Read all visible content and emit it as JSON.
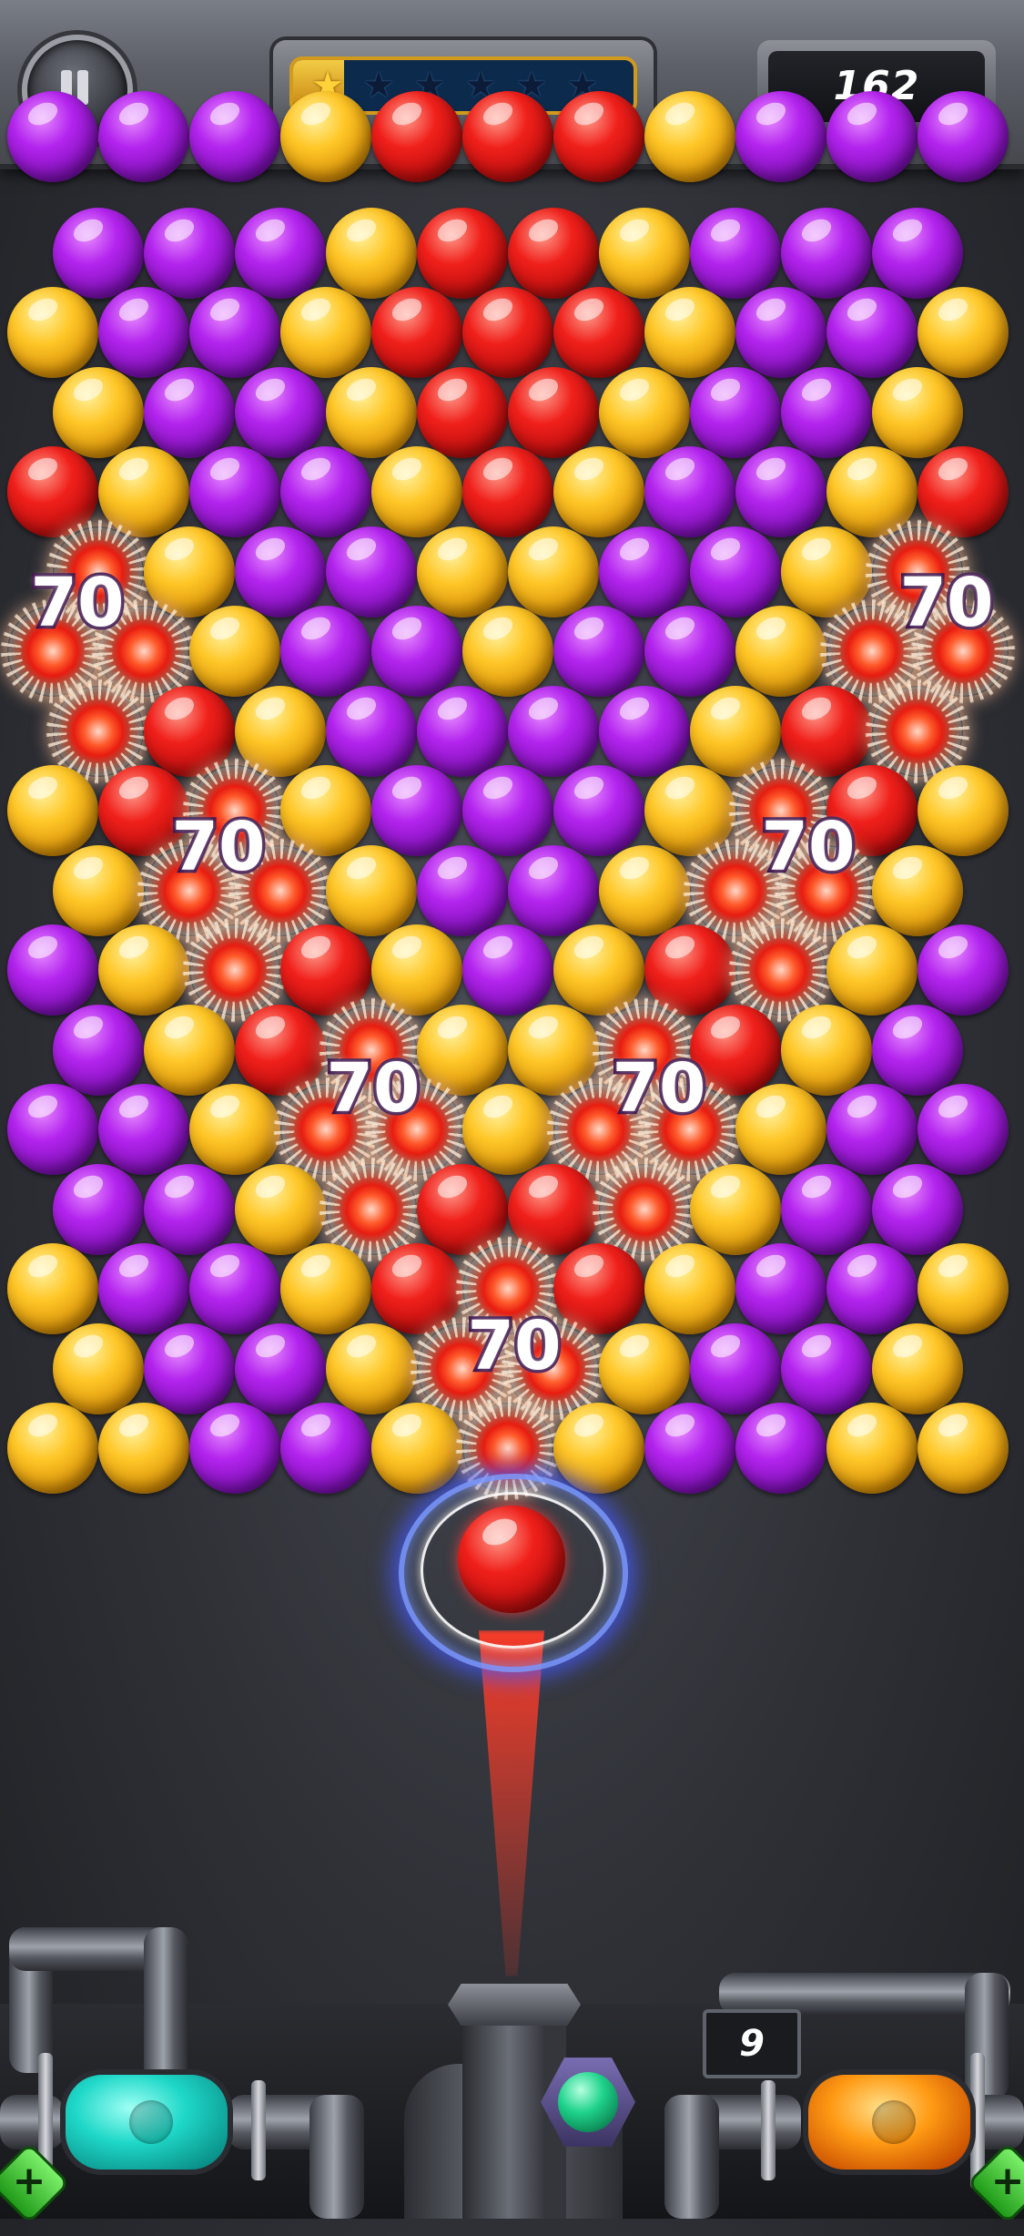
{
  "hud": {
    "pause_icon": "pause-icon",
    "star_progress": {
      "stars_total": 6,
      "stars_earned": 1,
      "fill_fraction": 0.15,
      "star_icon": "star-icon"
    },
    "score": "162"
  },
  "colors": {
    "purple": "#b324ee",
    "yellow": "#ffc728",
    "red": "#f0201b",
    "teal_booster": "#1fd8c8",
    "amber_booster": "#ff9a14",
    "next_bubble": "#1fd38b"
  },
  "board": {
    "rows": [
      "PPPYRRRYPPP",
      "PPPYRRYPPP",
      "YPPYRRRYPPY",
      "YPPYRRYPPY",
      "RYPPYRYPPYR",
      "XYPPYYPPYX",
      "XXYPPYPPYXX",
      "XRYPPPPYRX",
      "YRXYPPPYXRY",
      "YXXYPPYXXY",
      "PYXRYPYRXYP",
      "PYRXYYXRYP",
      "PPYXXYXXYPP",
      "PPYXRRXYPP",
      "YPPYRXRYPPY",
      "YPPYXXYPPY",
      "YYPPYXYPPYY"
    ]
  },
  "score_popups": [
    "70",
    "70",
    "70",
    "70",
    "70",
    "70",
    "70"
  ],
  "shooter": {
    "current_bubble": "red",
    "next_bubble": "green"
  },
  "boosters": {
    "left": "teal-bomb",
    "right": "fire-bomb",
    "right_count": "9"
  }
}
